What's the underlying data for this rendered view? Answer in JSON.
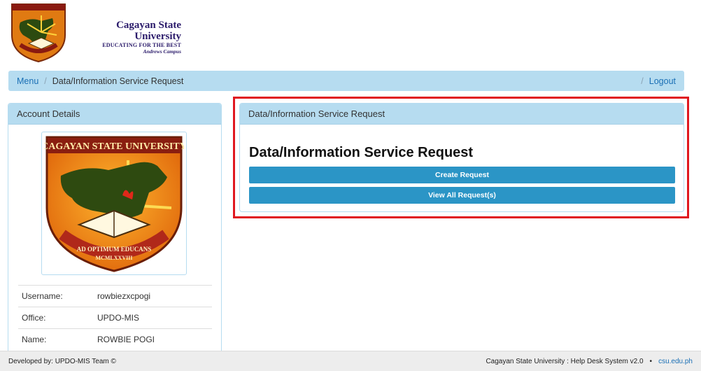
{
  "header": {
    "university_name": "Cagayan State University",
    "tagline": "EDUCATING FOR THE BEST",
    "campus": "Andrews Campus",
    "logo_icon": "csu-logo-icon"
  },
  "breadcrumb": {
    "menu": "Menu",
    "separator": "/",
    "current": "Data/Information Service Request",
    "logout": "Logout"
  },
  "account": {
    "heading": "Account Details",
    "seal": {
      "top_text": "CAGAYAN STATE UNIVERSITY",
      "motto": "AD OPTIMUM EDUCANS",
      "year": "MCMLXXVIII"
    },
    "fields": [
      {
        "label": "Username:",
        "value": "rowbiezxcpogi"
      },
      {
        "label": "Office:",
        "value": "UPDO-MIS"
      },
      {
        "label": "Name:",
        "value": "ROWBIE POGI"
      }
    ]
  },
  "request": {
    "heading": "Data/Information Service Request",
    "title": "Data/Information Service Request",
    "create_label": "Create Request",
    "view_label": "View All Request(s)"
  },
  "footer": {
    "left": "Developed by: UPDO-MIS Team ©",
    "system": "Cagayan State University : Help Desk System v2.0",
    "bullet": "•",
    "link": "csu.edu.ph"
  },
  "colors": {
    "breadcrumb_bg": "#b6dcf0",
    "button_bg": "#2b95c6",
    "highlight_border": "#e0171f",
    "link": "#1a6fb5"
  }
}
